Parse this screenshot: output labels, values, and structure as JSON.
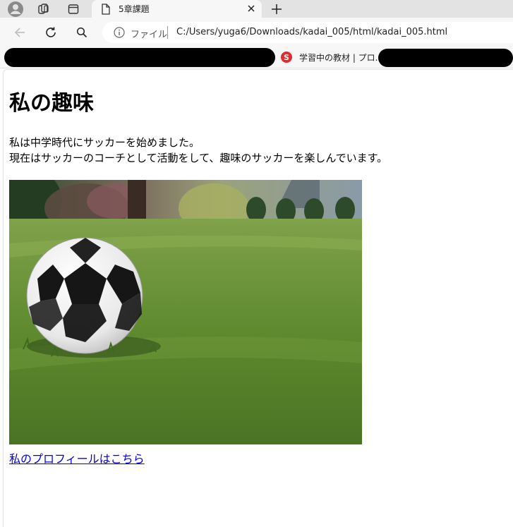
{
  "browser": {
    "tab": {
      "title": "5章課題"
    },
    "address": {
      "scheme_label": "ファイル",
      "url": "C:/Users/yuga6/Downloads/kadai_005/html/kadai_005.html"
    },
    "bookmarks": [
      {
        "label": "学習中の教材 | プロ...",
        "icon": "samurai-logo-icon",
        "icon_color": "#e02c2c"
      }
    ]
  },
  "page": {
    "title": "私の趣味",
    "paragraph_lines": [
      "私は中学時代にサッカーを始めました。",
      "現在はサッカーのコーチとして活動をして、趣味のサッカーを楽しんでいます。"
    ],
    "image": {
      "subject": "soccer ball on grass"
    },
    "link_text": "私のプロフィールはこちら"
  },
  "colors": {
    "tabstrip_bg": "#e3e3e3",
    "toolbar_bg": "#f7f7f7",
    "link": "#0000ee"
  }
}
